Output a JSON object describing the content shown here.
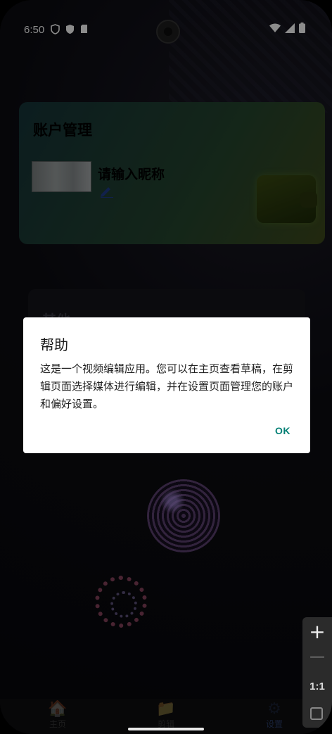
{
  "status": {
    "time": "6:50"
  },
  "account": {
    "title": "账户管理",
    "nickname_placeholder": "请输入昵称"
  },
  "other_section": {
    "title": "其他"
  },
  "dialog": {
    "title": "帮助",
    "message": "这是一个视频编辑应用。您可以在主页查看草稿，在剪辑页面选择媒体进行编辑，并在设置页面管理您的账户和偏好设置。",
    "ok_label": "OK"
  },
  "bottom_nav": {
    "items": [
      {
        "label": "主页",
        "icon": "home-icon"
      },
      {
        "label": "剪辑",
        "icon": "folder-icon"
      },
      {
        "label": "设置",
        "icon": "gear-icon"
      }
    ]
  },
  "zoom_panel": {
    "ratio_label": "1:1"
  },
  "colors": {
    "dialog_accent": "#017f74",
    "card_gradient": [
      "#16353a",
      "#3e4a1c"
    ]
  }
}
